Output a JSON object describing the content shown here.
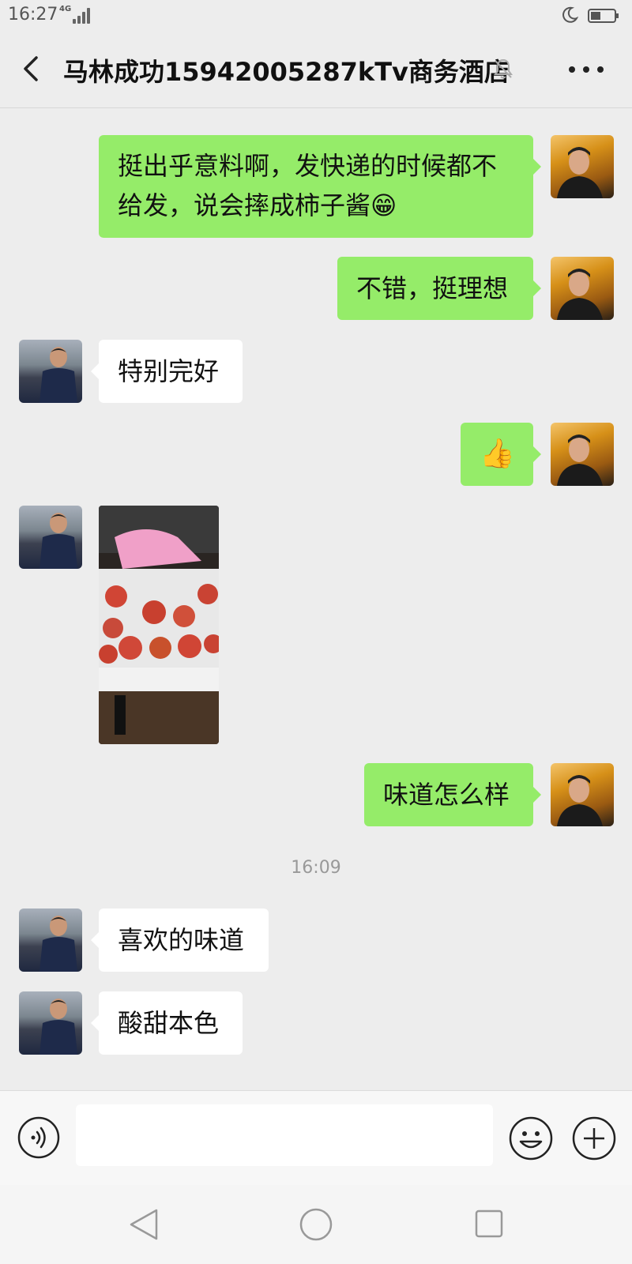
{
  "status_bar": {
    "time": "16:27",
    "network": "4G"
  },
  "header": {
    "title": "马林成功15942005287kTv商务酒店"
  },
  "colors": {
    "self_bubble": "#95ec69",
    "other_bubble": "#ffffff",
    "background": "#ededed"
  },
  "messages": [
    {
      "sender": "self",
      "type": "text",
      "text": "挺出乎意料啊，发快递的时候都不给发，说会摔成柿子酱😁"
    },
    {
      "sender": "self",
      "type": "text",
      "text": "不错，挺理想"
    },
    {
      "sender": "other",
      "type": "text",
      "text": "特别完好"
    },
    {
      "sender": "self",
      "type": "emoji",
      "text": "👍"
    },
    {
      "sender": "other",
      "type": "image",
      "icon": "tomatoes-photo"
    },
    {
      "sender": "self",
      "type": "text",
      "text": "味道怎么样"
    },
    {
      "type": "timestamp",
      "text": "16:09"
    },
    {
      "sender": "other",
      "type": "text",
      "text": "喜欢的味道"
    },
    {
      "sender": "other",
      "type": "text",
      "text": "酸甜本色"
    }
  ],
  "input_bar": {
    "value": "",
    "placeholder": ""
  }
}
